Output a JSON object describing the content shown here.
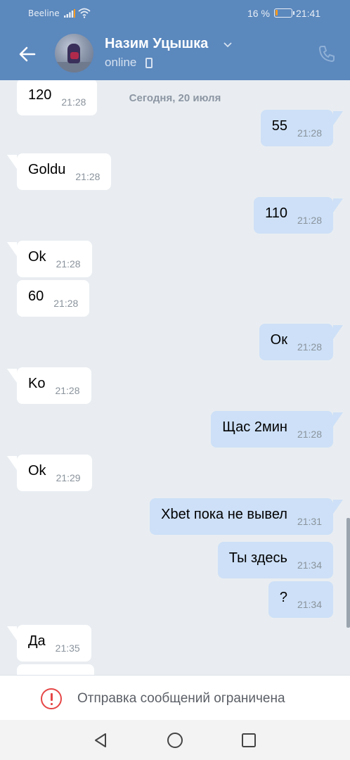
{
  "status_bar": {
    "carrier": "Beeline",
    "battery_percent": "16 %",
    "battery_level": 0.16,
    "battery_color": "#ff9a1f",
    "time": "21:41"
  },
  "header": {
    "contact_name": "Назим Уцышка",
    "presence": "online",
    "background": "#5b88bd",
    "icons": [
      "back-arrow-icon",
      "chevron-down-icon",
      "mobile-phone-icon",
      "phone-call-icon"
    ]
  },
  "chat": {
    "date_separator": "Сегодня, 20 июля",
    "incoming_color": "#ffffff",
    "outgoing_color": "#cde0f7",
    "messages": [
      {
        "dir": "in",
        "text": "120",
        "time": "21:28"
      },
      {
        "dir": "out",
        "text": "55",
        "time": "21:28"
      },
      {
        "dir": "in",
        "text": "Goldu",
        "time": "21:28"
      },
      {
        "dir": "out",
        "text": "110",
        "time": "21:28"
      },
      {
        "dir": "in",
        "text": "Ok",
        "time": "21:28"
      },
      {
        "dir": "in",
        "text": "60",
        "time": "21:28"
      },
      {
        "dir": "out",
        "text": "Ок",
        "time": "21:28"
      },
      {
        "dir": "in",
        "text": "Ko",
        "time": "21:28"
      },
      {
        "dir": "out",
        "text": "Щас 2мин",
        "time": "21:28"
      },
      {
        "dir": "in",
        "text": "Ok",
        "time": "21:29"
      },
      {
        "dir": "out",
        "text": "Xbet пока не вывел",
        "time": "21:31"
      },
      {
        "dir": "out",
        "text": "Ты здесь",
        "time": "21:34"
      },
      {
        "dir": "out",
        "text": "?",
        "time": "21:34"
      },
      {
        "dir": "in",
        "text": "Да",
        "time": "21:35"
      },
      {
        "dir": "in",
        "text": "",
        "time": ""
      }
    ]
  },
  "restricted": {
    "text": "Отправка сообщений ограничена",
    "icon": "warning-circle-icon",
    "icon_color": "#e64646"
  },
  "nav_bar": {
    "icons": [
      "back-triangle-icon",
      "home-circle-icon",
      "recents-square-icon"
    ]
  }
}
